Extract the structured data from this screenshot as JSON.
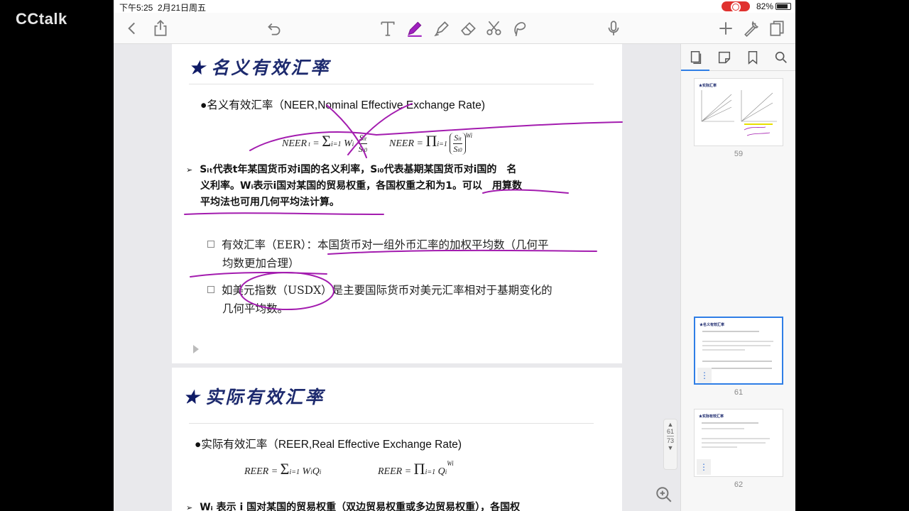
{
  "overlay": {
    "watermark": "CCtalk"
  },
  "status_bar": {
    "time": "下午5:25",
    "date": "2月21日周五",
    "battery": "82%"
  },
  "toolbar": {
    "left": [
      "back-icon",
      "share-icon",
      "undo-icon"
    ],
    "tools": [
      "text-tool-icon",
      "pen-tool-icon",
      "highlighter-icon",
      "eraser-icon",
      "scissors-icon",
      "lasso-icon",
      "microphone-icon"
    ],
    "right": [
      "add-icon",
      "wrench-icon",
      "pages-icon"
    ],
    "accent_color": "#a020c0"
  },
  "page1": {
    "heading": "名义有效汇率",
    "star": "★",
    "bullet": "●名义有效汇率（NEER,Nominal Effective Exchange Rate)",
    "formula_left": "NEER",
    "formula_right": "NEER",
    "explain_line1": "Sᵢₜ代表t年某国货币对i国的名义利率，Sᵢ₀代表基期某国货币对i国的　名",
    "explain_line2": "义利率。Wᵢ表示i国对某国的贸易权重，各国权重之和为1。可以　用算数",
    "explain_line3": "平均法也可用几何平均法计算。",
    "arrow": "➢",
    "sub1_line1": "有效汇率（EER）：本国货币对一组外币汇率的加权平均数（几何平",
    "sub1_line2": "均数更加合理）",
    "sub2_line1": "如美元指数（USDX）是主要国际货币对美元汇率相对于基期变化的",
    "sub2_line2": "几何平均数。"
  },
  "page2": {
    "heading": "实际有效汇率",
    "star": "★",
    "bullet": "●实际有效汇率（REER,Real Effective Exchange Rate)",
    "formula_left": "REER",
    "formula_right": "REER",
    "partial_line": "Wᵢ 表示  i  国对某国的贸易权重（双边贸易权重或多边贸易权重），各国权"
  },
  "scroll_indicator": {
    "current": "61",
    "total": "73"
  },
  "thumbnails": [
    {
      "page": "59",
      "title": "★实际汇率"
    },
    {
      "page": "61",
      "title": "★名义有效汇率",
      "selected": true
    },
    {
      "page": "62",
      "title": "★实际有效汇率"
    }
  ],
  "annotation_color": "#a31caf"
}
